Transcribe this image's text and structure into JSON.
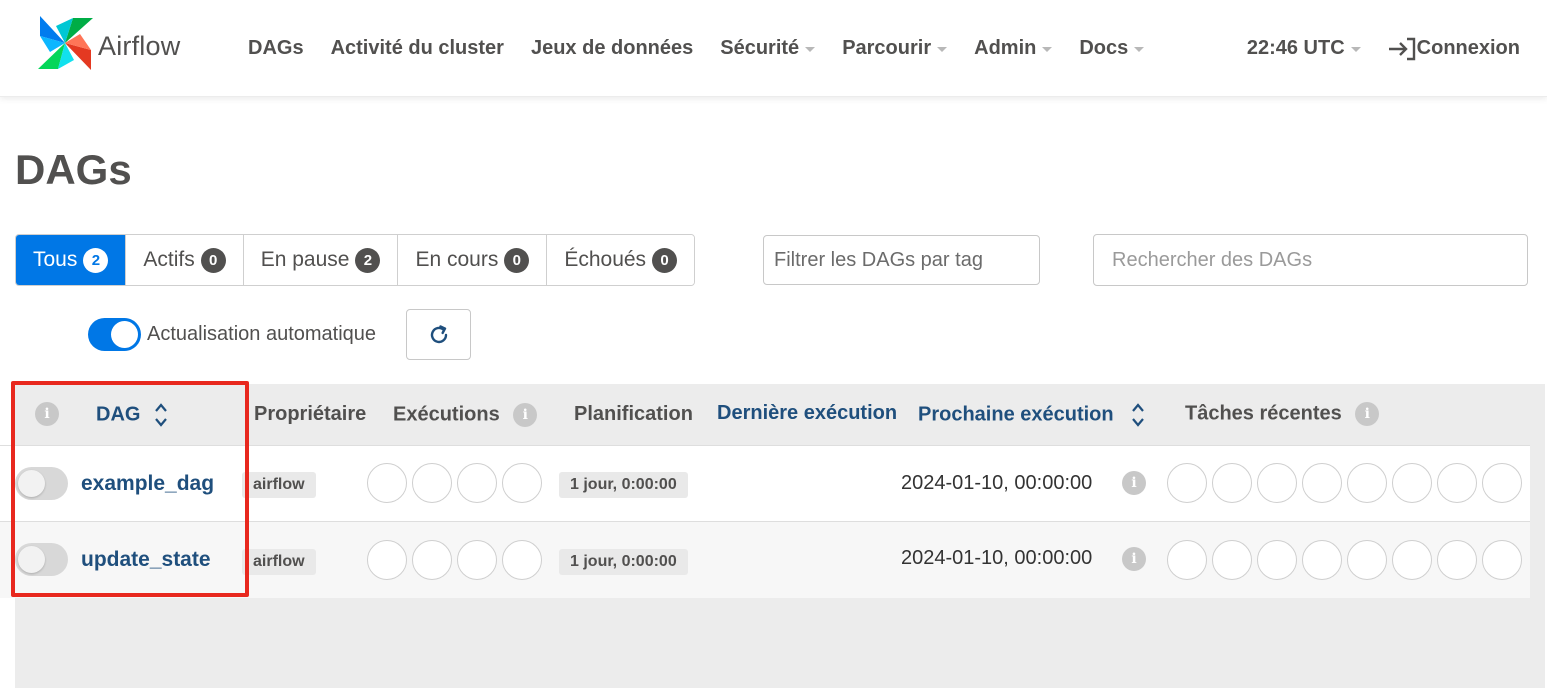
{
  "brand": {
    "name": "Airflow",
    "logo_icon": "pinwheel-icon"
  },
  "nav": {
    "items": [
      {
        "label": "DAGs",
        "dropdown": false
      },
      {
        "label": "Activité du cluster",
        "dropdown": false
      },
      {
        "label": "Jeux de données",
        "dropdown": false
      },
      {
        "label": "Sécurité",
        "dropdown": true
      },
      {
        "label": "Parcourir",
        "dropdown": true
      },
      {
        "label": "Admin",
        "dropdown": true
      },
      {
        "label": "Docs",
        "dropdown": true
      }
    ],
    "time": "22:46 UTC",
    "login": "Connexion"
  },
  "page": {
    "title": "DAGs"
  },
  "status_tabs": [
    {
      "label": "Tous",
      "count": "2",
      "active": true
    },
    {
      "label": "Actifs",
      "count": "0",
      "active": false
    },
    {
      "label": "En pause",
      "count": "2",
      "active": false
    },
    {
      "label": "En cours",
      "count": "0",
      "active": false
    },
    {
      "label": "Échoués",
      "count": "0",
      "active": false
    }
  ],
  "filters": {
    "tag_placeholder": "Filtrer les DAGs par tag",
    "search_placeholder": "Rechercher des DAGs"
  },
  "auto_refresh": {
    "label": "Actualisation automatique",
    "enabled": true
  },
  "table": {
    "headers": {
      "dag": "DAG",
      "owner": "Propriétaire",
      "runs": "Exécutions",
      "schedule": "Planification",
      "last_run": "Dernière exécution",
      "next_run": "Prochaine exécution",
      "recent_tasks": "Tâches récentes"
    },
    "rows": [
      {
        "dag_id": "example_dag",
        "owner": "airflow",
        "schedule": "1 jour, 0:00:00",
        "next_run": "2024-01-10, 00:00:00",
        "paused": true
      },
      {
        "dag_id": "update_state",
        "owner": "airflow",
        "schedule": "1 jour, 0:00:00",
        "next_run": "2024-01-10, 00:00:00",
        "paused": true
      }
    ]
  },
  "colors": {
    "primary": "#0077e6",
    "link": "#1f4f7d",
    "highlight": "#e8281e",
    "text": "#51504f"
  }
}
